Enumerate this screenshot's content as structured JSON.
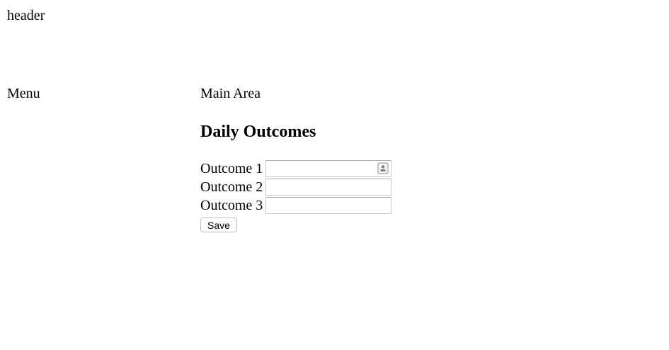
{
  "header": {
    "text": "header"
  },
  "menu": {
    "text": "Menu"
  },
  "main": {
    "title": "Main Area",
    "section_title": "Daily Outcomes",
    "fields": [
      {
        "label": "Outcome 1",
        "value": "",
        "icon": "contact-card-icon"
      },
      {
        "label": "Outcome 2",
        "value": ""
      },
      {
        "label": "Outcome 3",
        "value": ""
      }
    ],
    "save_label": "Save"
  }
}
